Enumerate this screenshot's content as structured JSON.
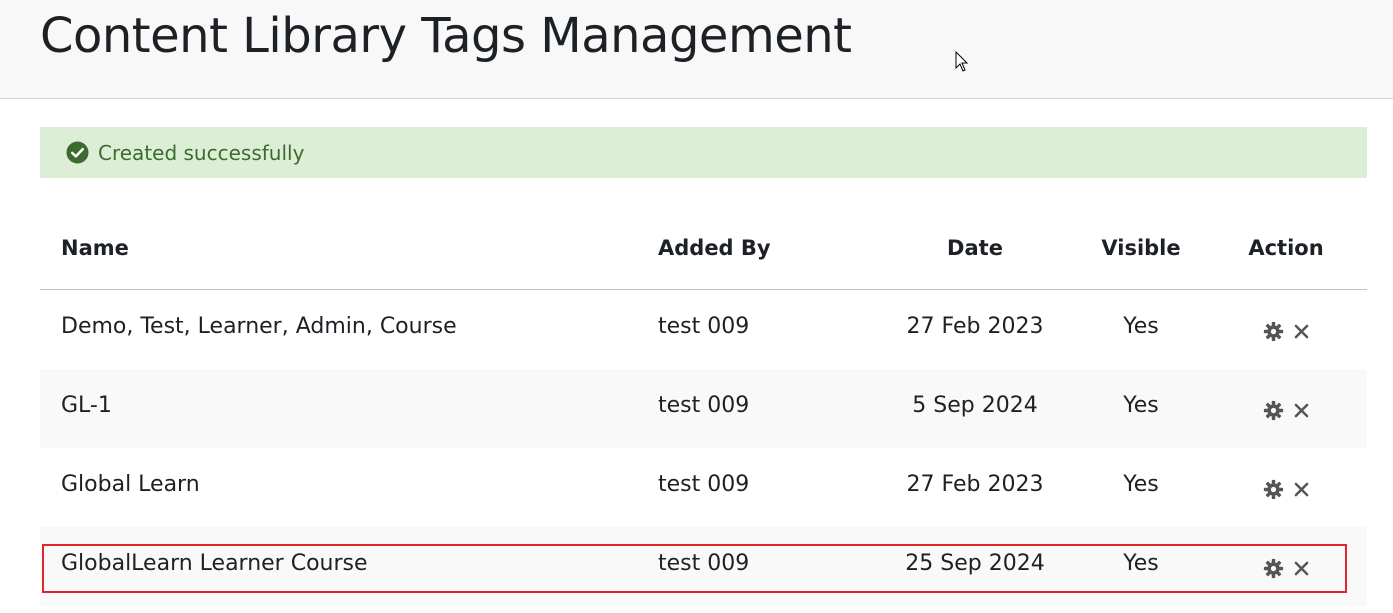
{
  "header": {
    "title": "Content Library Tags Management"
  },
  "alert": {
    "message": "Created successfully",
    "icon": "check-circle-icon",
    "color": "#3c6b30"
  },
  "table": {
    "columns": {
      "name": "Name",
      "added_by": "Added By",
      "date": "Date",
      "visible": "Visible",
      "action": "Action"
    },
    "rows": [
      {
        "name": "Demo, Test, Learner, Admin, Course",
        "added_by": "test 009",
        "date": "27 Feb 2023",
        "visible": "Yes"
      },
      {
        "name": "GL-1",
        "added_by": "test 009",
        "date": "5 Sep 2024",
        "visible": "Yes"
      },
      {
        "name": "Global Learn",
        "added_by": "test 009",
        "date": "27 Feb 2023",
        "visible": "Yes"
      },
      {
        "name": "GlobalLearn Learner Course",
        "added_by": "test 009",
        "date": "25 Sep 2024",
        "visible": "Yes"
      }
    ]
  }
}
